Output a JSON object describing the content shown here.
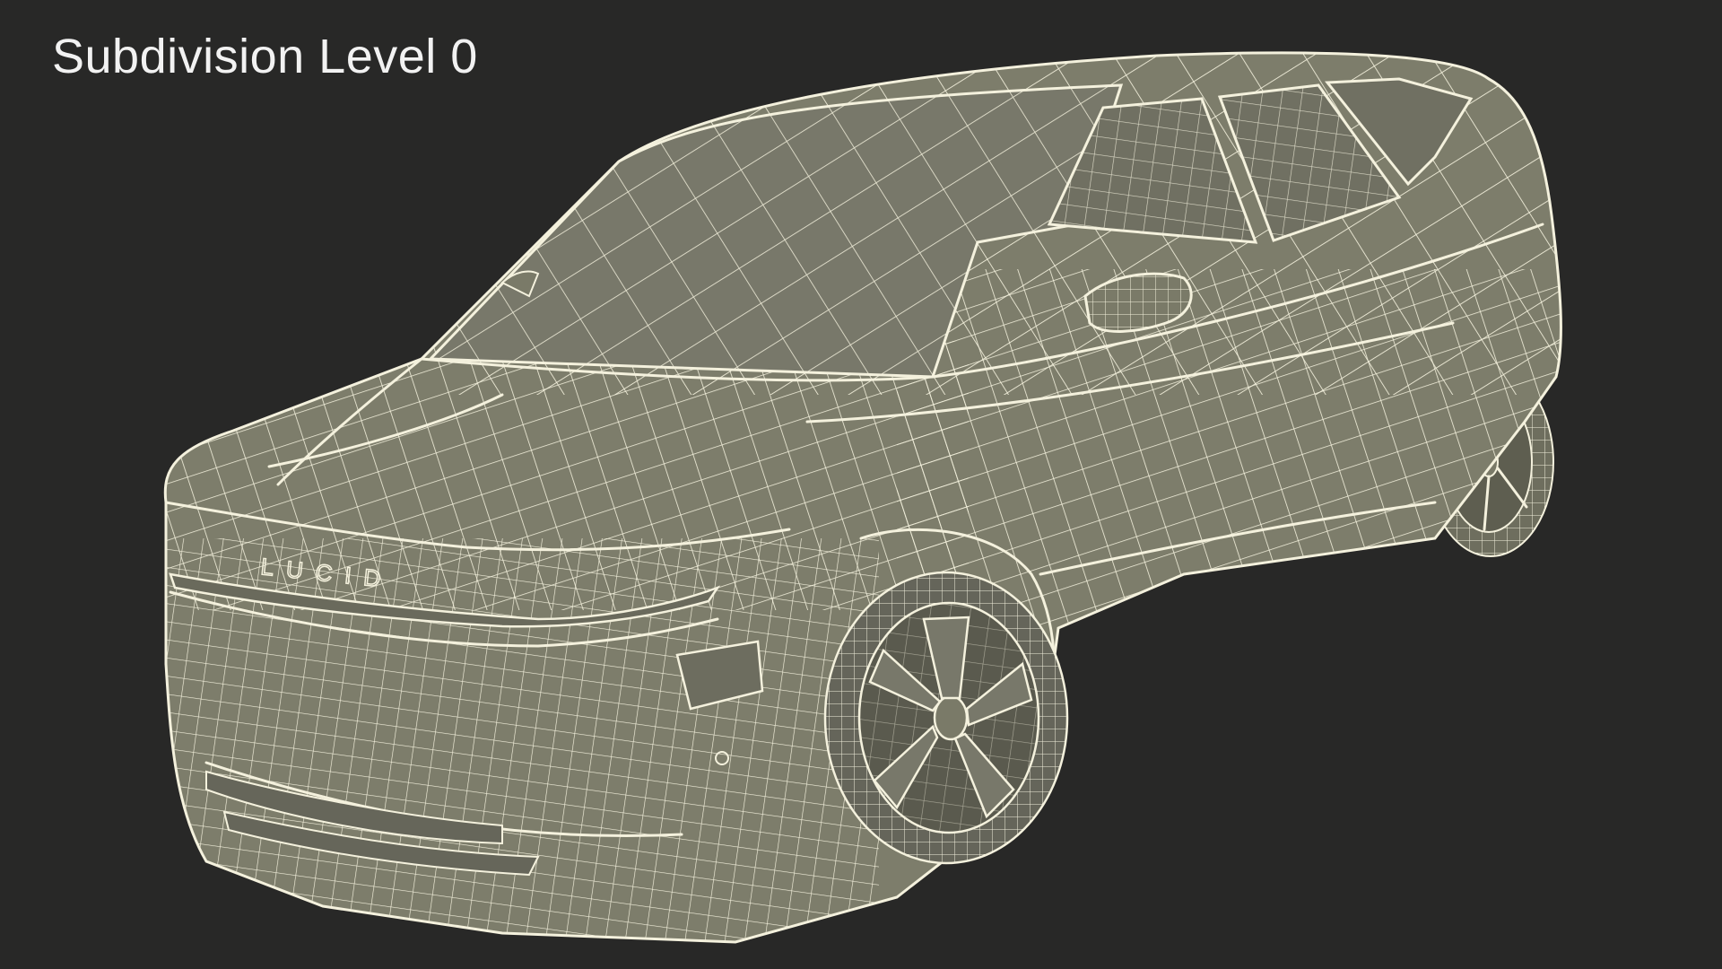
{
  "viewport": {
    "title": "Subdivision Level 0",
    "background_color": "#282827",
    "model_color": "#7c7c6a",
    "wire_color": "#f4f1dd"
  },
  "model": {
    "description_label": "",
    "badge_text": "LUCID"
  }
}
